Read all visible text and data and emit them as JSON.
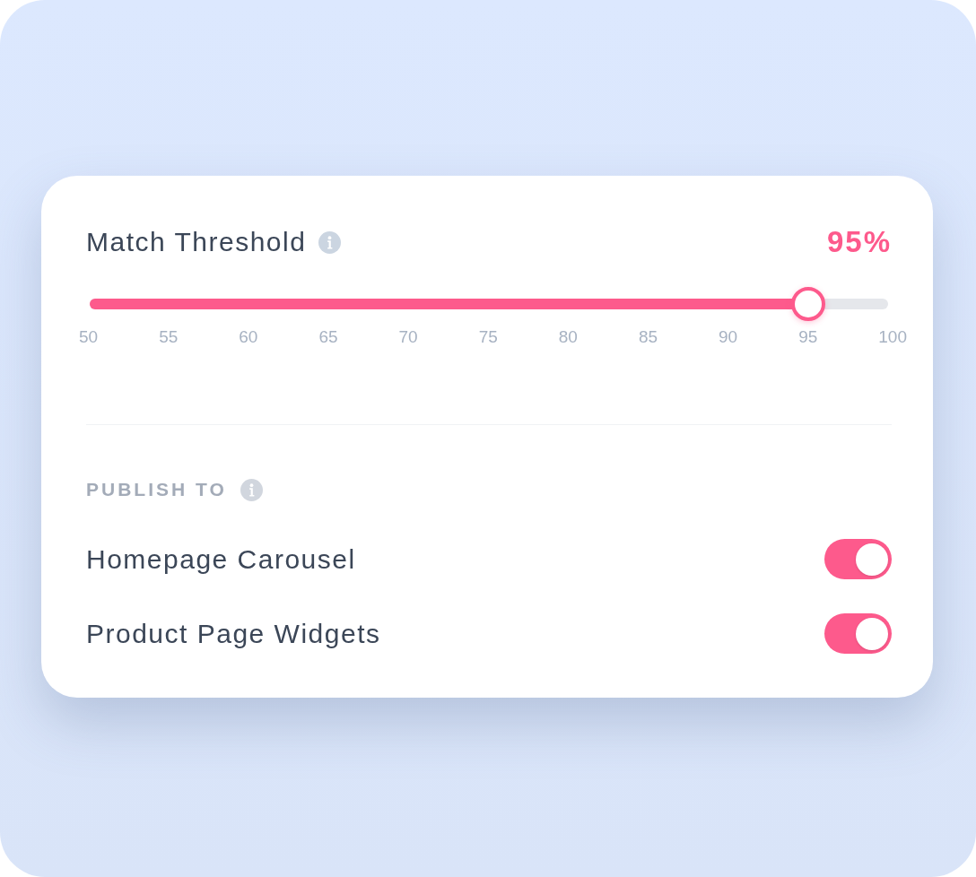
{
  "threshold": {
    "label": "Match Threshold",
    "value": "95%",
    "slider": {
      "level": 0.9
    },
    "ticks": [
      "50",
      "55",
      "60",
      "65",
      "70",
      "75",
      "80",
      "85",
      "90",
      "95",
      "100"
    ]
  },
  "publish": {
    "heading": "PUBLISH TO",
    "targets": [
      {
        "label": "Homepage Carousel",
        "on": true
      },
      {
        "label": "Product Page Widgets",
        "on": true
      }
    ]
  }
}
